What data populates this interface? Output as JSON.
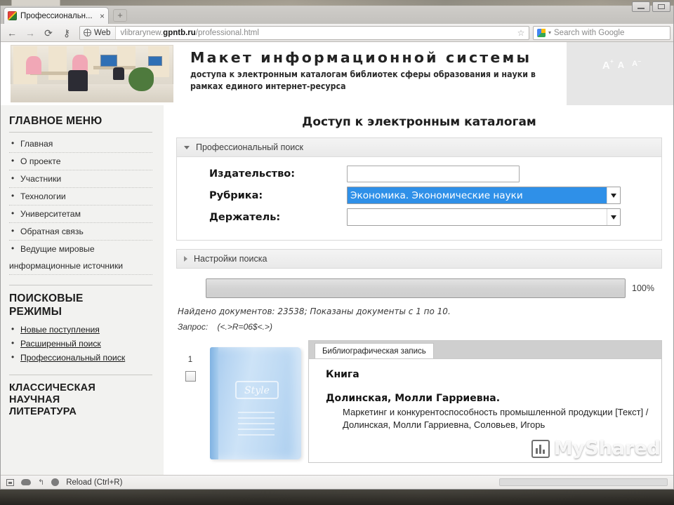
{
  "browser": {
    "tab": {
      "title": "Профессиональн...",
      "close": "×"
    },
    "new_tab": "+",
    "nav": {
      "back": "←",
      "forward": "→",
      "reload": "⟳",
      "key": "⚷"
    },
    "url": {
      "badge": "Web",
      "prefix": "vlibrarynew.",
      "host": "gpntb.ru",
      "path": "/professional.html"
    },
    "star": "☆",
    "search": {
      "placeholder": "Search with Google",
      "caret": "▾"
    },
    "status": {
      "reload_hint": "Reload (Ctrl+R)"
    }
  },
  "banner": {
    "title": "Макет информационной системы",
    "subtitle": "доступа к электронным каталогам библиотек сферы образования и науки  в рамках единого интернет-ресурса",
    "font_large": "A",
    "font_large_sup": "+",
    "font_medium": "A",
    "font_small": "A",
    "font_small_sup": "−"
  },
  "sidebar": {
    "main_menu_heading": "ГЛАВНОЕ МЕНЮ",
    "menu_items": [
      {
        "label": "Главная"
      },
      {
        "label": "О проекте"
      },
      {
        "label": "Участники"
      },
      {
        "label": "Технологии"
      },
      {
        "label": "Университетам"
      },
      {
        "label": "Обратная связь"
      },
      {
        "label": "Ведущие мировые"
      },
      {
        "label": "информационные источники"
      }
    ],
    "modes_heading_line1": "ПОИСКОВЫЕ",
    "modes_heading_line2": "РЕЖИМЫ",
    "modes": [
      {
        "label": "Новые поступления"
      },
      {
        "label": "Расширенный поиск"
      },
      {
        "label": "Профессиональный поиск"
      }
    ],
    "classic_heading_line1": "КЛАССИЧЕСКАЯ",
    "classic_heading_line2": "НАУЧНАЯ",
    "classic_heading_line3": "ЛИТЕРАТУРА"
  },
  "main": {
    "page_title": "Доступ к электронным каталогам",
    "search_panel_title": "Профессиональный поиск",
    "settings_panel_title": "Настройки поиска",
    "fields": [
      {
        "label": "Издательство:",
        "value": "",
        "type": "text"
      },
      {
        "label": "Рубрика:",
        "value": "Экономика. Экономические  науки",
        "type": "select",
        "selected": true
      },
      {
        "label": "Держатель:",
        "value": "",
        "type": "select",
        "selected": false
      }
    ],
    "progress": {
      "percent_label": "100%",
      "value": 100
    },
    "found_text": "Найдено документов: 23538; Показаны документы с 1 по 10.",
    "query_label": "Запрос:",
    "query_value": "(<.>R=06$<.>)",
    "record": {
      "number": "1",
      "tab_label": "Библиографическая запись",
      "type": "Книга",
      "author": "Долинская, Молли Гарриевна.",
      "description": "Маркетинг и конкурентоспособность промышленной продукции [Текст] / Долинская, Молли Гарриевна, Соловьев, Игорь",
      "cover_logo": "Style"
    }
  },
  "watermark": {
    "text": "MyShared"
  },
  "colors": {
    "select_highlight": "#2f90e8",
    "panel_border": "#d9d9d9",
    "page_bg": "#f2f2f0",
    "link": "#1a1a1a"
  }
}
